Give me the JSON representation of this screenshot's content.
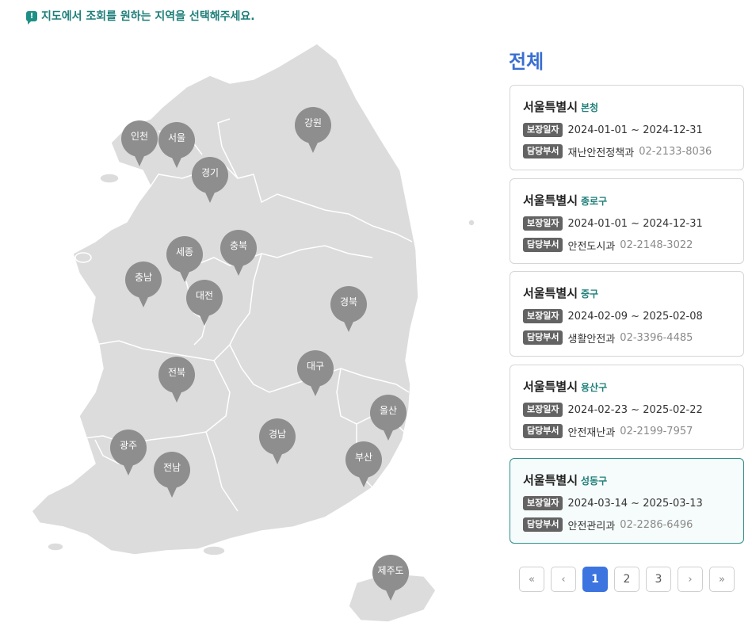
{
  "notice": {
    "icon": "alert-bubble-icon",
    "text": "지도에서 조회를 원하는 지역을 선택해주세요."
  },
  "map": {
    "regions": [
      {
        "name": "인천"
      },
      {
        "name": "서울"
      },
      {
        "name": "경기"
      },
      {
        "name": "강원"
      },
      {
        "name": "세종"
      },
      {
        "name": "충북"
      },
      {
        "name": "충남"
      },
      {
        "name": "대전"
      },
      {
        "name": "경북"
      },
      {
        "name": "대구"
      },
      {
        "name": "전북"
      },
      {
        "name": "울산"
      },
      {
        "name": "경남"
      },
      {
        "name": "광주"
      },
      {
        "name": "전남"
      },
      {
        "name": "부산"
      },
      {
        "name": "제주도"
      }
    ],
    "colors": {
      "land": "#dcdcdc",
      "border": "#ffffff",
      "pin": "#8e8e8e"
    }
  },
  "sidebar": {
    "title": "전체",
    "date_tag": "보장일자",
    "dept_tag": "담당부서",
    "cards": [
      {
        "city": "서울특별시",
        "district": "본청",
        "period": "2024-01-01 ~ 2024-12-31",
        "dept": "재난안전정책과",
        "phone": "02-2133-8036"
      },
      {
        "city": "서울특별시",
        "district": "종로구",
        "period": "2024-01-01 ~ 2024-12-31",
        "dept": "안전도시과",
        "phone": "02-2148-3022"
      },
      {
        "city": "서울특별시",
        "district": "중구",
        "period": "2024-02-09 ~ 2025-02-08",
        "dept": "생활안전과",
        "phone": "02-3396-4485"
      },
      {
        "city": "서울특별시",
        "district": "용산구",
        "period": "2024-02-23 ~ 2025-02-22",
        "dept": "안전재난과",
        "phone": "02-2199-7957"
      },
      {
        "city": "서울특별시",
        "district": "성동구",
        "period": "2024-03-14 ~ 2025-03-13",
        "dept": "안전관리과",
        "phone": "02-2286-6496",
        "selected": true
      }
    ]
  },
  "pagination": {
    "first": "«",
    "prev": "‹",
    "next": "›",
    "last": "»",
    "pages": [
      "1",
      "2",
      "3"
    ],
    "current": "1"
  },
  "colors": {
    "accent": "#3c74e0",
    "teal": "#1e7f7a",
    "tag": "#636363"
  }
}
